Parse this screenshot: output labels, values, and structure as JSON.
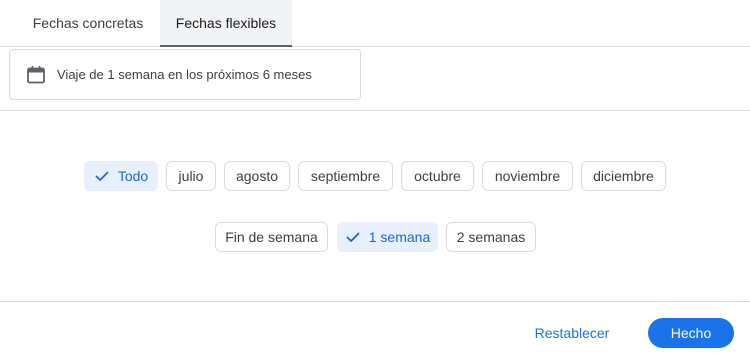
{
  "tabs": {
    "specific_label": "Fechas concretas",
    "flexible_label": "Fechas flexibles",
    "active": "flexible"
  },
  "summary": {
    "icon": "calendar-icon",
    "text": "Viaje de 1 semana en los próximos 6 meses"
  },
  "months": {
    "items": [
      {
        "label": "Todo",
        "selected": true
      },
      {
        "label": "julio",
        "selected": false
      },
      {
        "label": "agosto",
        "selected": false
      },
      {
        "label": "septiembre",
        "selected": false
      },
      {
        "label": "octubre",
        "selected": false
      },
      {
        "label": "noviembre",
        "selected": false
      },
      {
        "label": "diciembre",
        "selected": false
      }
    ]
  },
  "durations": {
    "items": [
      {
        "label": "Fin de semana",
        "selected": false
      },
      {
        "label": "1 semana",
        "selected": true
      },
      {
        "label": "2 semanas",
        "selected": false
      }
    ]
  },
  "footer": {
    "reset_label": "Restablecer",
    "done_label": "Hecho"
  },
  "colors": {
    "accent": "#1a73e8",
    "selected_chip_bg": "#e8f0fe",
    "selected_chip_text": "#1967d2",
    "border": "#dadce0"
  }
}
